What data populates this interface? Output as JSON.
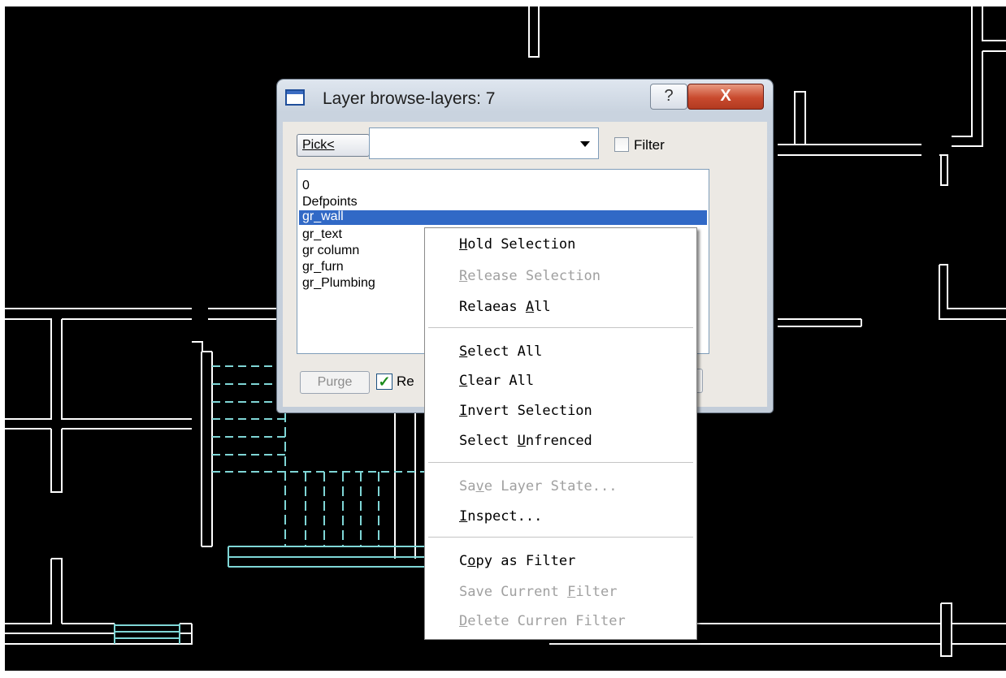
{
  "dialog": {
    "title": "Layer browse-layers: 7",
    "help_glyph": "?",
    "close_glyph": "X",
    "pick_label": "Pick<",
    "combo_value": "",
    "filter_label": "Filter",
    "filter_checked": false,
    "layers": [
      "0",
      "Defpoints",
      "gr_wall",
      "gr_text",
      "gr column",
      "gr_furn",
      "gr_Plumbing"
    ],
    "selected_layer": "gr_wall",
    "purge_label": "Purge",
    "re_label": "Re",
    "re_checked": true
  },
  "context_menu": {
    "items": [
      {
        "label": "Hold Selection",
        "mnemonic": "H",
        "enabled": true
      },
      {
        "label": "Release Selection",
        "mnemonic": "R",
        "enabled": false
      },
      {
        "label": "Relaeas All",
        "mnemonic": "A",
        "enabled": true
      },
      {
        "label": "Select All",
        "mnemonic": "S",
        "enabled": true
      },
      {
        "label": "Clear All",
        "mnemonic": "C",
        "enabled": true
      },
      {
        "label": "Invert Selection",
        "mnemonic": "I",
        "enabled": true
      },
      {
        "label": "Select Unfrenced",
        "mnemonic": "U",
        "enabled": true
      },
      {
        "label": "Save Layer State...",
        "mnemonic": "v",
        "enabled": false
      },
      {
        "label": "Inspect...",
        "mnemonic": "I",
        "enabled": true
      },
      {
        "label": "Copy as Filter",
        "mnemonic": "o",
        "enabled": true
      },
      {
        "label": "Save Current Filter",
        "mnemonic": "F",
        "enabled": false
      },
      {
        "label": "Delete Curren Filter",
        "mnemonic": "D",
        "enabled": false
      }
    ]
  },
  "colors": {
    "canvas_bg": "#000000",
    "wall_lines": "#ffffff",
    "stair_lines": "#7fd6d6",
    "selection": "#3169c6"
  }
}
